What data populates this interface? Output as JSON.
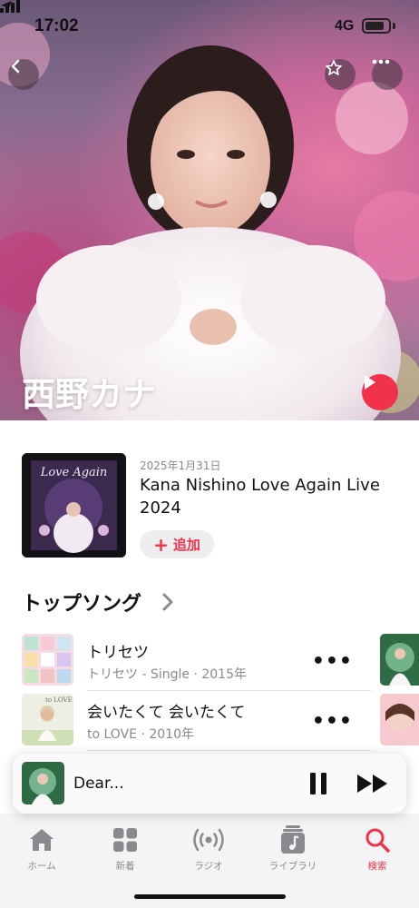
{
  "status_bar": {
    "time": "17:02",
    "network": "4G",
    "battery_level": 0.82
  },
  "artist": {
    "name": "西野カナ"
  },
  "latest_release": {
    "date": "2025年1月31日",
    "title": "Kana Nishino Love Again Live 2024",
    "add_label": "追加",
    "cover_text": "Love Again"
  },
  "top_songs": {
    "title": "トップソング",
    "items": [
      {
        "title": "トリセツ",
        "subtitle": "トリセツ - Single · 2015年"
      },
      {
        "title": "会いたくて 会いたくて",
        "subtitle": "to LOVE · 2010年",
        "art_text": "to LOVE"
      }
    ]
  },
  "mini_player": {
    "title": "Dear..."
  },
  "tabs": [
    {
      "label": "ホーム",
      "icon": "house-icon",
      "active": false
    },
    {
      "label": "新着",
      "icon": "grid-icon",
      "active": false
    },
    {
      "label": "ラジオ",
      "icon": "radio-waves-icon",
      "active": false
    },
    {
      "label": "ライブラリ",
      "icon": "music-note-icon",
      "active": false
    },
    {
      "label": "検索",
      "icon": "search-icon",
      "active": true
    }
  ],
  "colors": {
    "accent": "#f0334a",
    "secondary_text": "#8a8a8e",
    "tabbar_bg": "#f4f4f6"
  }
}
